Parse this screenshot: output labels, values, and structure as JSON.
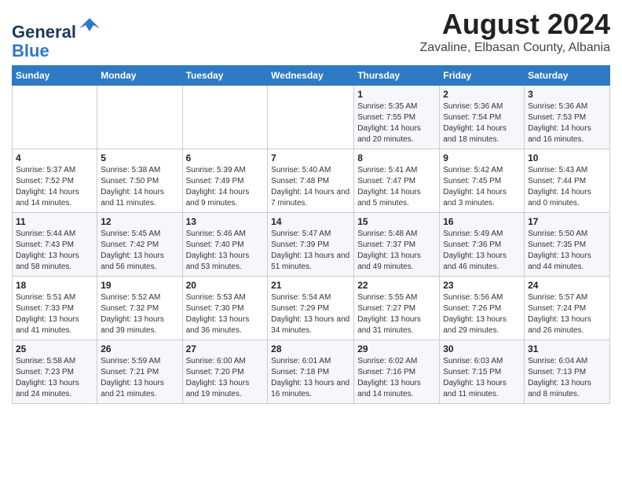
{
  "header": {
    "logo_line1": "General",
    "logo_line2": "Blue",
    "main_title": "August 2024",
    "subtitle": "Zavaline, Elbasan County, Albania"
  },
  "columns": [
    "Sunday",
    "Monday",
    "Tuesday",
    "Wednesday",
    "Thursday",
    "Friday",
    "Saturday"
  ],
  "weeks": [
    {
      "days": [
        {
          "num": "",
          "detail": ""
        },
        {
          "num": "",
          "detail": ""
        },
        {
          "num": "",
          "detail": ""
        },
        {
          "num": "",
          "detail": ""
        },
        {
          "num": "1",
          "detail": "Sunrise: 5:35 AM\nSunset: 7:55 PM\nDaylight: 14 hours and 20 minutes."
        },
        {
          "num": "2",
          "detail": "Sunrise: 5:36 AM\nSunset: 7:54 PM\nDaylight: 14 hours and 18 minutes."
        },
        {
          "num": "3",
          "detail": "Sunrise: 5:36 AM\nSunset: 7:53 PM\nDaylight: 14 hours and 16 minutes."
        }
      ]
    },
    {
      "days": [
        {
          "num": "4",
          "detail": "Sunrise: 5:37 AM\nSunset: 7:52 PM\nDaylight: 14 hours and 14 minutes."
        },
        {
          "num": "5",
          "detail": "Sunrise: 5:38 AM\nSunset: 7:50 PM\nDaylight: 14 hours and 11 minutes."
        },
        {
          "num": "6",
          "detail": "Sunrise: 5:39 AM\nSunset: 7:49 PM\nDaylight: 14 hours and 9 minutes."
        },
        {
          "num": "7",
          "detail": "Sunrise: 5:40 AM\nSunset: 7:48 PM\nDaylight: 14 hours and 7 minutes."
        },
        {
          "num": "8",
          "detail": "Sunrise: 5:41 AM\nSunset: 7:47 PM\nDaylight: 14 hours and 5 minutes."
        },
        {
          "num": "9",
          "detail": "Sunrise: 5:42 AM\nSunset: 7:45 PM\nDaylight: 14 hours and 3 minutes."
        },
        {
          "num": "10",
          "detail": "Sunrise: 5:43 AM\nSunset: 7:44 PM\nDaylight: 14 hours and 0 minutes."
        }
      ]
    },
    {
      "days": [
        {
          "num": "11",
          "detail": "Sunrise: 5:44 AM\nSunset: 7:43 PM\nDaylight: 13 hours and 58 minutes."
        },
        {
          "num": "12",
          "detail": "Sunrise: 5:45 AM\nSunset: 7:42 PM\nDaylight: 13 hours and 56 minutes."
        },
        {
          "num": "13",
          "detail": "Sunrise: 5:46 AM\nSunset: 7:40 PM\nDaylight: 13 hours and 53 minutes."
        },
        {
          "num": "14",
          "detail": "Sunrise: 5:47 AM\nSunset: 7:39 PM\nDaylight: 13 hours and 51 minutes."
        },
        {
          "num": "15",
          "detail": "Sunrise: 5:48 AM\nSunset: 7:37 PM\nDaylight: 13 hours and 49 minutes."
        },
        {
          "num": "16",
          "detail": "Sunrise: 5:49 AM\nSunset: 7:36 PM\nDaylight: 13 hours and 46 minutes."
        },
        {
          "num": "17",
          "detail": "Sunrise: 5:50 AM\nSunset: 7:35 PM\nDaylight: 13 hours and 44 minutes."
        }
      ]
    },
    {
      "days": [
        {
          "num": "18",
          "detail": "Sunrise: 5:51 AM\nSunset: 7:33 PM\nDaylight: 13 hours and 41 minutes."
        },
        {
          "num": "19",
          "detail": "Sunrise: 5:52 AM\nSunset: 7:32 PM\nDaylight: 13 hours and 39 minutes."
        },
        {
          "num": "20",
          "detail": "Sunrise: 5:53 AM\nSunset: 7:30 PM\nDaylight: 13 hours and 36 minutes."
        },
        {
          "num": "21",
          "detail": "Sunrise: 5:54 AM\nSunset: 7:29 PM\nDaylight: 13 hours and 34 minutes."
        },
        {
          "num": "22",
          "detail": "Sunrise: 5:55 AM\nSunset: 7:27 PM\nDaylight: 13 hours and 31 minutes."
        },
        {
          "num": "23",
          "detail": "Sunrise: 5:56 AM\nSunset: 7:26 PM\nDaylight: 13 hours and 29 minutes."
        },
        {
          "num": "24",
          "detail": "Sunrise: 5:57 AM\nSunset: 7:24 PM\nDaylight: 13 hours and 26 minutes."
        }
      ]
    },
    {
      "days": [
        {
          "num": "25",
          "detail": "Sunrise: 5:58 AM\nSunset: 7:23 PM\nDaylight: 13 hours and 24 minutes."
        },
        {
          "num": "26",
          "detail": "Sunrise: 5:59 AM\nSunset: 7:21 PM\nDaylight: 13 hours and 21 minutes."
        },
        {
          "num": "27",
          "detail": "Sunrise: 6:00 AM\nSunset: 7:20 PM\nDaylight: 13 hours and 19 minutes."
        },
        {
          "num": "28",
          "detail": "Sunrise: 6:01 AM\nSunset: 7:18 PM\nDaylight: 13 hours and 16 minutes."
        },
        {
          "num": "29",
          "detail": "Sunrise: 6:02 AM\nSunset: 7:16 PM\nDaylight: 13 hours and 14 minutes."
        },
        {
          "num": "30",
          "detail": "Sunrise: 6:03 AM\nSunset: 7:15 PM\nDaylight: 13 hours and 11 minutes."
        },
        {
          "num": "31",
          "detail": "Sunrise: 6:04 AM\nSunset: 7:13 PM\nDaylight: 13 hours and 8 minutes."
        }
      ]
    }
  ]
}
